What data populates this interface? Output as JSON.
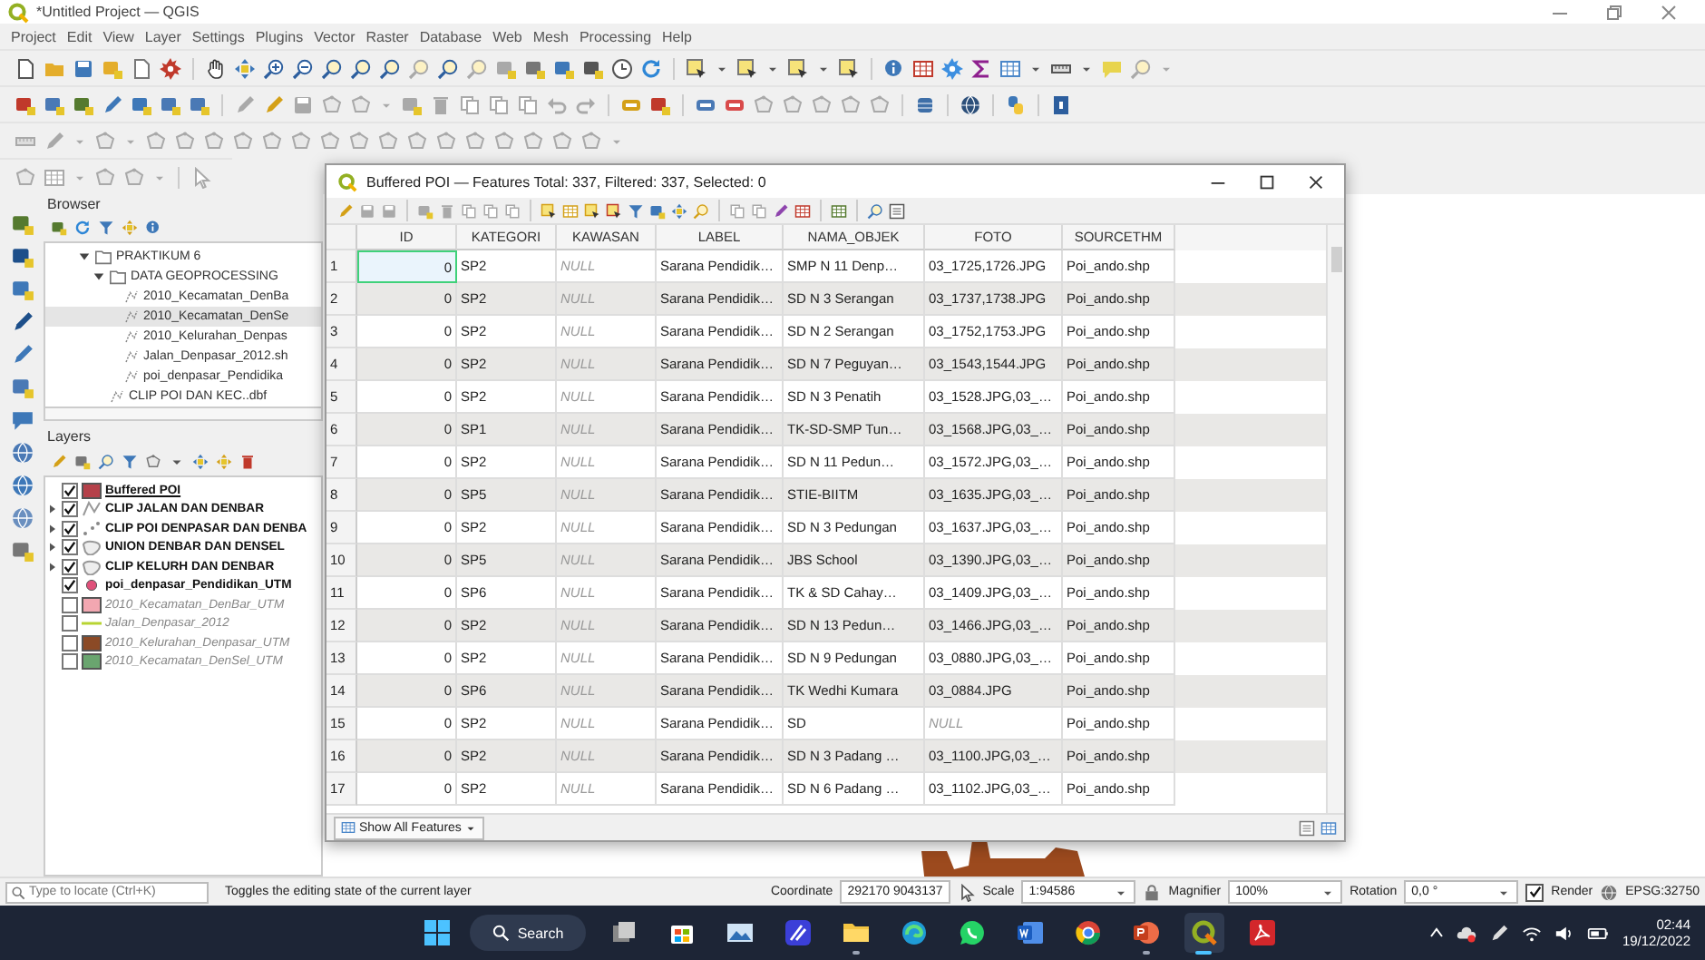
{
  "window": {
    "title": "*Untitled Project — QGIS"
  },
  "menu": [
    "Project",
    "Edit",
    "View",
    "Layer",
    "Settings",
    "Plugins",
    "Vector",
    "Raster",
    "Database",
    "Web",
    "Mesh",
    "Processing",
    "Help"
  ],
  "browser": {
    "title": "Browser",
    "tree": [
      {
        "label": "PRAKTIKUM 6",
        "kind": "folder",
        "expanded": true,
        "selected": false,
        "children": [
          {
            "label": "DATA GEOPROCESSING",
            "kind": "folder",
            "expanded": true,
            "selected": false,
            "children": [
              {
                "label": "2010_Kecamatan_DenBa",
                "kind": "file",
                "selected": false
              },
              {
                "label": "2010_Kecamatan_DenSe",
                "kind": "file",
                "selected": true
              },
              {
                "label": "2010_Kelurahan_Denpas",
                "kind": "file",
                "selected": false
              },
              {
                "label": "Jalan_Denpasar_2012.sh",
                "kind": "file",
                "selected": false
              },
              {
                "label": "poi_denpasar_Pendidika",
                "kind": "file",
                "selected": false
              }
            ]
          },
          {
            "label": "CLIP POI DAN KEC..dbf",
            "kind": "file",
            "selected": false
          }
        ]
      }
    ]
  },
  "layers": {
    "title": "Layers",
    "items": [
      {
        "name": "Buffered POI",
        "checked": true,
        "selected": true,
        "has_children": false,
        "kind": "fill",
        "color": "#b5414a"
      },
      {
        "name": "CLIP JALAN DAN DENBAR",
        "checked": true,
        "selected": false,
        "has_children": true,
        "kind": "vector-line"
      },
      {
        "name": "CLIP POI DENPASAR DAN DENBA",
        "checked": true,
        "selected": false,
        "has_children": true,
        "kind": "vector-points"
      },
      {
        "name": "UNION DENBAR DAN DENSEL",
        "checked": true,
        "selected": false,
        "has_children": true,
        "kind": "vector-polygon"
      },
      {
        "name": "CLIP KELURH DAN DENBAR",
        "checked": true,
        "selected": false,
        "has_children": true,
        "kind": "vector-polygon"
      },
      {
        "name": "poi_denpasar_Pendidikan_UTM",
        "checked": true,
        "selected": false,
        "has_children": false,
        "kind": "marker",
        "color": "#e0507a"
      },
      {
        "name": "2010_Kecamatan_DenBar_UTM",
        "checked": false,
        "selected": false,
        "has_children": false,
        "kind": "fill",
        "color": "#f2a7b1"
      },
      {
        "name": "Jalan_Denpasar_2012",
        "checked": false,
        "selected": false,
        "has_children": false,
        "kind": "line",
        "color": "#b8d432"
      },
      {
        "name": "2010_Kelurahan_Denpasar_UTM",
        "checked": false,
        "selected": false,
        "has_children": false,
        "kind": "fill",
        "color": "#8b4a26"
      },
      {
        "name": "2010_Kecamatan_DenSel_UTM",
        "checked": false,
        "selected": false,
        "has_children": false,
        "kind": "fill",
        "color": "#6aa56f"
      }
    ]
  },
  "attribute_table": {
    "title": "Buffered POI — Features Total: 337, Filtered: 337, Selected: 0",
    "columns": [
      "ID",
      "KATEGORI",
      "KAWASAN",
      "LABEL",
      "NAMA_OBJEK",
      "FOTO",
      "SOURCETHM"
    ],
    "rows": [
      {
        "number": "1",
        "current": true,
        "cells": [
          "0",
          "SP2",
          {
            "text": "NULL",
            "is_null": true
          },
          "Sarana Pendidik…",
          "SMP N 11 Denp…",
          "03_1725,1726.JPG",
          "Poi_ando.shp"
        ]
      },
      {
        "number": "2",
        "current": false,
        "cells": [
          "0",
          "SP2",
          {
            "text": "NULL",
            "is_null": true
          },
          "Sarana Pendidik…",
          "SD N 3 Serangan",
          "03_1737,1738.JPG",
          "Poi_ando.shp"
        ]
      },
      {
        "number": "3",
        "current": false,
        "cells": [
          "0",
          "SP2",
          {
            "text": "NULL",
            "is_null": true
          },
          "Sarana Pendidik…",
          "SD N 2 Serangan",
          "03_1752,1753.JPG",
          "Poi_ando.shp"
        ]
      },
      {
        "number": "4",
        "current": false,
        "cells": [
          "0",
          "SP2",
          {
            "text": "NULL",
            "is_null": true
          },
          "Sarana Pendidik…",
          "SD N 7 Peguyan…",
          "03_1543,1544.JPG",
          "Poi_ando.shp"
        ]
      },
      {
        "number": "5",
        "current": false,
        "cells": [
          "0",
          "SP2",
          {
            "text": "NULL",
            "is_null": true
          },
          "Sarana Pendidik…",
          "SD N 3 Penatih",
          "03_1528.JPG,03_…",
          "Poi_ando.shp"
        ]
      },
      {
        "number": "6",
        "current": false,
        "cells": [
          "0",
          "SP1",
          {
            "text": "NULL",
            "is_null": true
          },
          "Sarana Pendidik…",
          "TK-SD-SMP Tun…",
          "03_1568.JPG,03_…",
          "Poi_ando.shp"
        ]
      },
      {
        "number": "7",
        "current": false,
        "cells": [
          "0",
          "SP2",
          {
            "text": "NULL",
            "is_null": true
          },
          "Sarana Pendidik…",
          "SD N 11 Pedun…",
          "03_1572.JPG,03_…",
          "Poi_ando.shp"
        ]
      },
      {
        "number": "8",
        "current": false,
        "cells": [
          "0",
          "SP5",
          {
            "text": "NULL",
            "is_null": true
          },
          "Sarana Pendidik…",
          "STIE-BIITM",
          "03_1635.JPG,03_…",
          "Poi_ando.shp"
        ]
      },
      {
        "number": "9",
        "current": false,
        "cells": [
          "0",
          "SP2",
          {
            "text": "NULL",
            "is_null": true
          },
          "Sarana Pendidik…",
          "SD N 3 Pedungan",
          "03_1637.JPG,03_…",
          "Poi_ando.shp"
        ]
      },
      {
        "number": "10",
        "current": false,
        "cells": [
          "0",
          "SP5",
          {
            "text": "NULL",
            "is_null": true
          },
          "Sarana Pendidik…",
          "JBS School",
          "03_1390.JPG,03_…",
          "Poi_ando.shp"
        ]
      },
      {
        "number": "11",
        "current": false,
        "cells": [
          "0",
          "SP6",
          {
            "text": "NULL",
            "is_null": true
          },
          "Sarana Pendidik…",
          "TK & SD Cahay…",
          "03_1409.JPG,03_…",
          "Poi_ando.shp"
        ]
      },
      {
        "number": "12",
        "current": false,
        "cells": [
          "0",
          "SP2",
          {
            "text": "NULL",
            "is_null": true
          },
          "Sarana Pendidik…",
          "SD N 13 Pedun…",
          "03_1466.JPG,03_…",
          "Poi_ando.shp"
        ]
      },
      {
        "number": "13",
        "current": false,
        "cells": [
          "0",
          "SP2",
          {
            "text": "NULL",
            "is_null": true
          },
          "Sarana Pendidik…",
          "SD N 9 Pedungan",
          "03_0880.JPG,03_…",
          "Poi_ando.shp"
        ]
      },
      {
        "number": "14",
        "current": false,
        "cells": [
          "0",
          "SP6",
          {
            "text": "NULL",
            "is_null": true
          },
          "Sarana Pendidik…",
          "TK Wedhi Kumara",
          "03_0884.JPG",
          "Poi_ando.shp"
        ]
      },
      {
        "number": "15",
        "current": false,
        "cells": [
          "0",
          "SP2",
          {
            "text": "NULL",
            "is_null": true
          },
          "Sarana Pendidik…",
          "SD",
          {
            "text": "NULL",
            "is_null": true
          },
          "Poi_ando.shp"
        ]
      },
      {
        "number": "16",
        "current": false,
        "cells": [
          "0",
          "SP2",
          {
            "text": "NULL",
            "is_null": true
          },
          "Sarana Pendidik…",
          "SD N 3 Padang …",
          "03_1100.JPG,03_…",
          "Poi_ando.shp"
        ]
      },
      {
        "number": "17",
        "current": false,
        "cells": [
          "0",
          "SP2",
          {
            "text": "NULL",
            "is_null": true
          },
          "Sarana Pendidik…",
          "SD N 6 Padang …",
          "03_1102.JPG,03_…",
          "Poi_ando.shp"
        ]
      }
    ],
    "filter_button": "Show All Features"
  },
  "status_bar": {
    "locate_placeholder": "Type to locate (Ctrl+K)",
    "message": "Toggles the editing state of the current layer",
    "coordinate_label": "Coordinate",
    "coordinate": "292170 9043137",
    "scale_label": "Scale",
    "scale": "1:94586",
    "magnifier_label": "Magnifier",
    "magnifier": "100%",
    "rotation_label": "Rotation",
    "rotation": "0,0 °",
    "render_checked": true,
    "render_label": "Render",
    "crs": "EPSG:32750"
  },
  "taskbar": {
    "search": "Search",
    "apps": [
      {
        "kind": "task-view",
        "running": false,
        "selected": false
      },
      {
        "kind": "store",
        "running": false,
        "selected": false
      },
      {
        "kind": "photos",
        "running": false,
        "selected": false
      },
      {
        "kind": "notes",
        "running": false,
        "selected": false
      },
      {
        "kind": "files",
        "running": true,
        "selected": false
      },
      {
        "kind": "edge",
        "running": false,
        "selected": false
      },
      {
        "kind": "chat",
        "running": false,
        "selected": false
      },
      {
        "kind": "doc",
        "running": false,
        "selected": false
      },
      {
        "kind": "web",
        "running": false,
        "selected": false
      },
      {
        "kind": "slides",
        "running": true,
        "selected": false
      },
      {
        "kind": "gis",
        "running": true,
        "selected": true
      },
      {
        "kind": "pdf",
        "running": false,
        "selected": false
      }
    ],
    "time": "02:44",
    "date": "19/12/2022"
  }
}
